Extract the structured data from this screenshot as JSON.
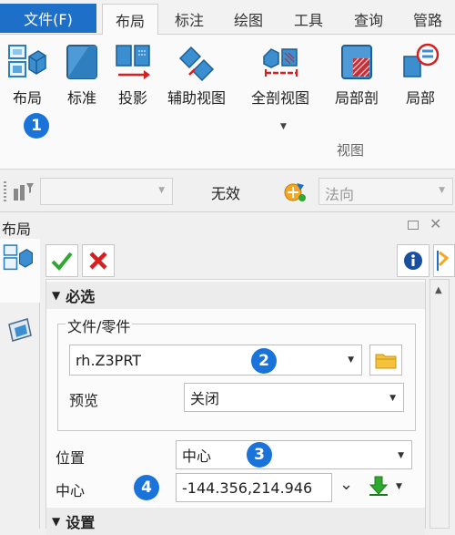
{
  "menu": {
    "file": "文件(F)",
    "tabs": [
      "布局",
      "标注",
      "绘图",
      "工具",
      "查询",
      "管路"
    ],
    "active_tab": "布局"
  },
  "ribbon": {
    "buttons": [
      "布局",
      "标准",
      "投影",
      "辅助视图",
      "全剖视图",
      "局部剖",
      "局部"
    ],
    "group_label": "视图"
  },
  "filterbar": {
    "status_text": "无效",
    "direction_value": "法向"
  },
  "panel": {
    "title": "布局",
    "sections": {
      "required": "必选",
      "settings": "设置"
    },
    "file_part_group": "文件/零件",
    "file_value": "rh.Z3PRT",
    "preview_label": "预览",
    "preview_value": "关闭",
    "position_label": "位置",
    "position_value": "中心",
    "center_label": "中心",
    "center_value": "-144.356,214.946"
  },
  "badges": [
    "1",
    "2",
    "3",
    "4"
  ],
  "colors": {
    "accent": "#1e6fc7",
    "badge": "#1a73d9",
    "ok_green": "#2fa82f",
    "cancel_red": "#d62020"
  }
}
